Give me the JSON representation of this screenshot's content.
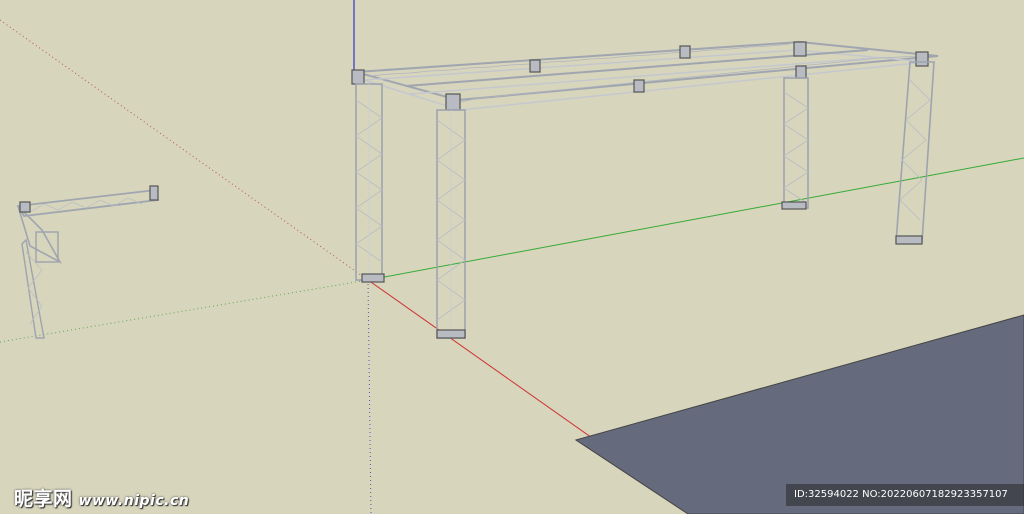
{
  "scene": {
    "background_color": "#d8d5bd",
    "axis_colors": {
      "red": "#cc3333",
      "green": "#33aa33",
      "blue": "#3333cc"
    },
    "ground_plane_color": "#656b7d",
    "truss_color": "#9ea4ae"
  },
  "watermark": {
    "brand": "昵享网",
    "url": "www.nipic.cn",
    "id_line": "ID:32594022 NO:20220607182923357107"
  }
}
